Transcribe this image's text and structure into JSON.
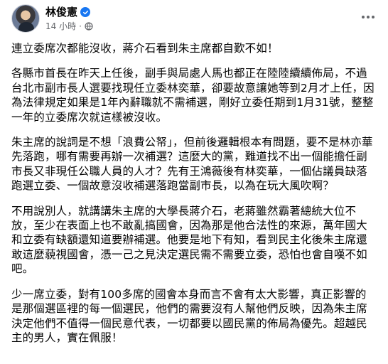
{
  "post": {
    "author_name": "林俊憲",
    "timestamp": "14 小時",
    "verified_icon": "verified-check-icon",
    "privacy_icon": "globe-icon",
    "more_icon": "more-horizontal-icon",
    "accent_color": "#1877f2",
    "paragraphs": [
      "連立委席次都能沒收，蔣介石看到朱主席都自歎不如！",
      "各縣市首長在昨天上任後，副手與局處人馬也都正在陸陸續續佈局，不過台北市副市長人選要找現任立委林奕華，卻要故意讓她等到2月才上任，因為法律規定如果是1年內辭職就不需補選，剛好立委任期到1月31號，整整一年的立委席次就這樣被沒收。",
      "朱主席的說詞是不想「浪費公帑」，但前後邏輯根本有問題，要不是林亦華先落跑，哪有需要再辦一次補選？這麼大的黨，難道找不出一個能擔任副市長又非現任公職人員的人才？先有王鴻薇後有林奕華，一個佔議員缺落跑選立委、一個故意沒收補選落跑當副市長，以為在玩大風吹啊？",
      "不用說別人，就講講朱主席的大學長蔣介石，老蔣雖然霸著總統大位不放，至少在表面上也不敢亂搞國會，因為那是他合法性的來源，萬年國大和立委有缺額還知道要辦補選。他要是地下有知，看到民主化後朱主席還敢這麼藐視國會，憑一己之見決定選民需不需要立委，恐怕也會自嘆不如吧。",
      "少一席立委，對有100多席的國會本身而言不會有太大影響，真正影響的是那個選區裡的每一個選民，他們的需要沒有人幫他們反映，因為朱主席決定他們不值得一個民意代表，一切都要以國民黨的佈局為優先。超越民主的男人，實在佩服！"
    ]
  }
}
